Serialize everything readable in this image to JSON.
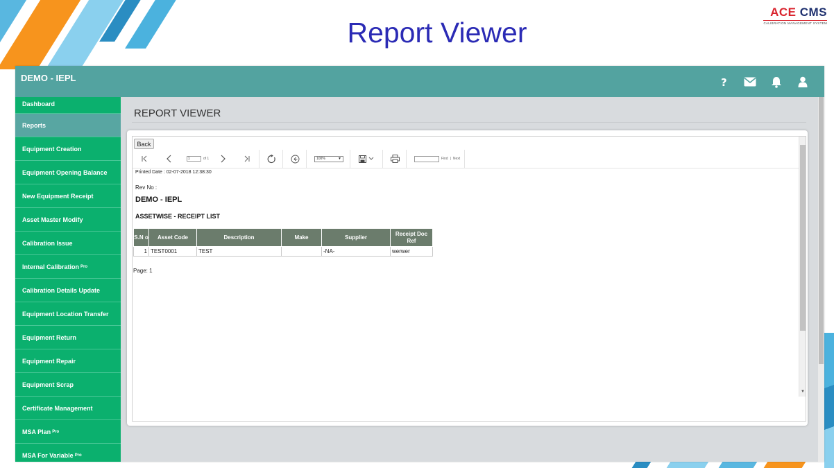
{
  "slide": {
    "title": "Report Viewer",
    "logo": {
      "main_a": "ACE",
      "main_b": "CMS",
      "sub": "CALIBRATION MANAGEMENT SYSTEM"
    }
  },
  "colors": {
    "header": "#53a3a0",
    "sidebar": "#0bb06e",
    "sidebar_active": "#58a6a2",
    "title": "#2b2bb5",
    "table_header": "#6b7c6c"
  },
  "app": {
    "brand": "DEMO - IEPL",
    "header_icons": [
      "help-icon",
      "mail-icon",
      "bell-icon",
      "user-icon"
    ]
  },
  "sidebar": {
    "items": [
      {
        "label": "Dashboard"
      },
      {
        "label": "Reports"
      },
      {
        "label": "Equipment Creation"
      },
      {
        "label": "Equipment Opening Balance"
      },
      {
        "label": "New Equipment Receipt"
      },
      {
        "label": "Asset Master Modify"
      },
      {
        "label": "Calibration Issue"
      },
      {
        "label": "Internal Calibration",
        "badge": "Pro"
      },
      {
        "label": "Calibration Details Update"
      },
      {
        "label": "Equipment Location Transfer"
      },
      {
        "label": "Equipment Return"
      },
      {
        "label": "Equipment Repair"
      },
      {
        "label": "Equipment Scrap"
      },
      {
        "label": "Certificate Management"
      },
      {
        "label": "MSA Plan",
        "badge": "Pro"
      },
      {
        "label": "MSA For Variable",
        "badge": "Pro"
      }
    ]
  },
  "content": {
    "heading": "REPORT VIEWER",
    "back_label": "Back",
    "toolbar": {
      "page_value": "1",
      "page_of": "of 1",
      "zoom": "100%",
      "find": "Find",
      "next": "Next"
    },
    "report": {
      "printed_date": "Printed Date : 02-07-2018 12:38:30",
      "rev_no": "Rev No :",
      "company": "DEMO - IEPL",
      "title": "ASSETWISE - RECEIPT LIST",
      "columns": [
        "S.N o",
        "Asset Code",
        "Description",
        "Make",
        "Supplier",
        "Receipt Doc Ref"
      ],
      "rows": [
        [
          "1",
          "TEST0001",
          "TEST",
          "",
          "-NA-",
          "werwer"
        ]
      ],
      "page": "Page: 1"
    }
  }
}
